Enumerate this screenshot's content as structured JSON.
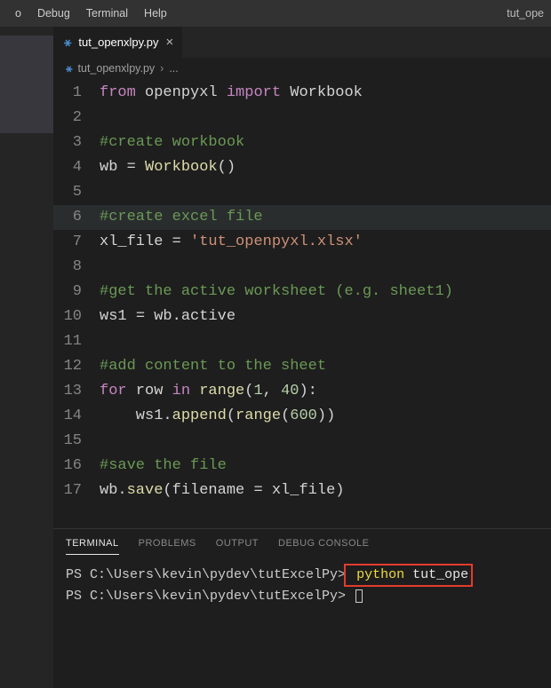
{
  "menubar": {
    "items": [
      "o",
      "Debug",
      "Terminal",
      "Help"
    ],
    "title": "tut_ope"
  },
  "tab": {
    "label": "tut_openxlpy.py"
  },
  "breadcrumb": {
    "file": "tut_openxlpy.py",
    "rest": "..."
  },
  "code": [
    {
      "n": "1",
      "tokens": [
        [
          "kw",
          "from"
        ],
        [
          "plain",
          " openpyxl "
        ],
        [
          "kw",
          "import"
        ],
        [
          "plain",
          " Workbook"
        ]
      ]
    },
    {
      "n": "2",
      "tokens": []
    },
    {
      "n": "3",
      "tokens": [
        [
          "cmt",
          "#create workbook"
        ]
      ]
    },
    {
      "n": "4",
      "tokens": [
        [
          "plain",
          "wb "
        ],
        [
          "op",
          "="
        ],
        [
          "plain",
          " "
        ],
        [
          "fn",
          "Workbook"
        ],
        [
          "plain",
          "()"
        ]
      ]
    },
    {
      "n": "5",
      "tokens": []
    },
    {
      "n": "6",
      "hl": true,
      "tokens": [
        [
          "cmt",
          "#create excel file"
        ]
      ]
    },
    {
      "n": "7",
      "tokens": [
        [
          "plain",
          "xl_file "
        ],
        [
          "op",
          "="
        ],
        [
          "plain",
          " "
        ],
        [
          "str",
          "'tut_openpyxl.xlsx'"
        ]
      ]
    },
    {
      "n": "8",
      "tokens": []
    },
    {
      "n": "9",
      "tokens": [
        [
          "cmt",
          "#get the active worksheet (e.g. sheet1)"
        ]
      ]
    },
    {
      "n": "10",
      "tokens": [
        [
          "plain",
          "ws1 "
        ],
        [
          "op",
          "="
        ],
        [
          "plain",
          " wb.active"
        ]
      ]
    },
    {
      "n": "11",
      "tokens": []
    },
    {
      "n": "12",
      "tokens": [
        [
          "cmt",
          "#add content to the sheet"
        ]
      ]
    },
    {
      "n": "13",
      "tokens": [
        [
          "kw",
          "for"
        ],
        [
          "plain",
          " row "
        ],
        [
          "kw",
          "in"
        ],
        [
          "plain",
          " "
        ],
        [
          "fn",
          "range"
        ],
        [
          "plain",
          "("
        ],
        [
          "num",
          "1"
        ],
        [
          "plain",
          ", "
        ],
        [
          "num",
          "40"
        ],
        [
          "plain",
          "):"
        ]
      ]
    },
    {
      "n": "14",
      "tokens": [
        [
          "plain",
          "    ws1."
        ],
        [
          "fn",
          "append"
        ],
        [
          "plain",
          "("
        ],
        [
          "fn",
          "range"
        ],
        [
          "plain",
          "("
        ],
        [
          "num",
          "600"
        ],
        [
          "plain",
          "))"
        ]
      ]
    },
    {
      "n": "15",
      "tokens": []
    },
    {
      "n": "16",
      "tokens": [
        [
          "cmt",
          "#save the file"
        ]
      ]
    },
    {
      "n": "17",
      "tokens": [
        [
          "plain",
          "wb."
        ],
        [
          "fn",
          "save"
        ],
        [
          "plain",
          "(filename "
        ],
        [
          "op",
          "="
        ],
        [
          "plain",
          " xl_file)"
        ]
      ]
    }
  ],
  "panel": {
    "tabs": [
      "TERMINAL",
      "PROBLEMS",
      "OUTPUT",
      "DEBUG CONSOLE"
    ],
    "active": 0,
    "lines": [
      {
        "prompt": "PS C:\\Users\\kevin\\pydev\\tutExcelPy>",
        "cmd_py": " python",
        "cmd_rest": " tut_ope",
        "highlight": true
      },
      {
        "prompt": "PS C:\\Users\\kevin\\pydev\\tutExcelPy>",
        "cursor": true
      }
    ]
  }
}
